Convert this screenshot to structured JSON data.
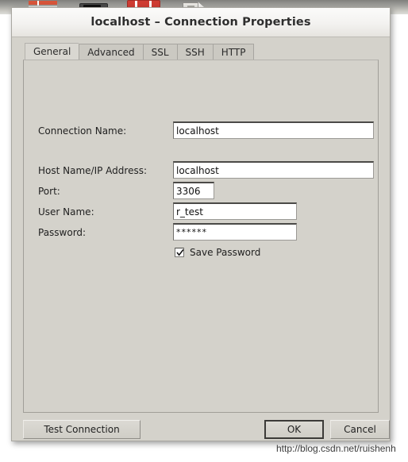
{
  "window": {
    "title": "localhost – Connection Properties"
  },
  "desktop": {
    "icons": [
      {
        "name": "spreadsheet-icon"
      },
      {
        "name": "device-icon"
      },
      {
        "name": "red-app-icon"
      },
      {
        "name": "document-monitor-icon"
      }
    ]
  },
  "tabs": [
    {
      "label": "General",
      "selected": true
    },
    {
      "label": "Advanced",
      "selected": false
    },
    {
      "label": "SSL",
      "selected": false
    },
    {
      "label": "SSH",
      "selected": false
    },
    {
      "label": "HTTP",
      "selected": false
    }
  ],
  "form": {
    "connection_name": {
      "label": "Connection Name:",
      "value": "localhost",
      "placeholder": ""
    },
    "host": {
      "label": "Host Name/IP Address:",
      "value": "localhost",
      "placeholder": ""
    },
    "port": {
      "label": "Port:",
      "value": "3306",
      "placeholder": ""
    },
    "user_name": {
      "label": "User Name:",
      "value": "r_test",
      "placeholder": ""
    },
    "password": {
      "label": "Password:",
      "value": "******",
      "placeholder": ""
    },
    "save_password": {
      "label": "Save Password",
      "checked": true
    }
  },
  "buttons": {
    "test_connection": "Test Connection",
    "ok": "OK",
    "cancel": "Cancel"
  },
  "watermark": {
    "text": "http://blog.csdn.net/ruishenh"
  }
}
